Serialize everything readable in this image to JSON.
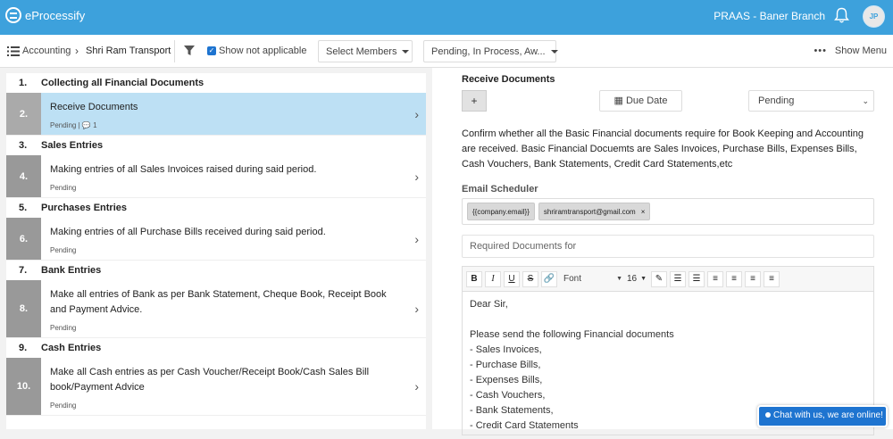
{
  "app": {
    "name": "eProcessify",
    "branch": "PRAAS - Baner Branch",
    "user_initials": "JP"
  },
  "toolbar": {
    "crumb_root": "Accounting",
    "crumb_current": "Shri Ram Transport",
    "show_not_applicable": "Show not applicable",
    "members_select": "Select Members",
    "status_filter": "Pending, In Process, Aw...",
    "show_menu": "Show Menu"
  },
  "tasks": [
    {
      "type": "section",
      "num": "1.",
      "title": "Collecting all Financial Documents"
    },
    {
      "type": "task",
      "num": "2.",
      "title": "Receive Documents",
      "status": "Pending  |  💬 1",
      "active": true
    },
    {
      "type": "section",
      "num": "3.",
      "title": "Sales Entries"
    },
    {
      "type": "task",
      "num": "4.",
      "title": "Making entries of all Sales Invoices raised during said period.",
      "status": "Pending"
    },
    {
      "type": "section",
      "num": "5.",
      "title": "Purchases Entries"
    },
    {
      "type": "task",
      "num": "6.",
      "title": "Making entries of all Purchase Bills received during said period.",
      "status": "Pending"
    },
    {
      "type": "section",
      "num": "7.",
      "title": "Bank Entries"
    },
    {
      "type": "task",
      "num": "8.",
      "title": "Make all entries of Bank as per Bank Statement, Cheque Book, Receipt Book and Payment Advice.",
      "status": "Pending"
    },
    {
      "type": "section",
      "num": "9.",
      "title": "Cash Entries"
    },
    {
      "type": "task",
      "num": "10.",
      "title": "Make all Cash entries as per Cash Voucher/Receipt Book/Cash Sales Bill book/Payment Advice",
      "status": "Pending"
    }
  ],
  "detail": {
    "title": "Receive Documents",
    "plus": "+",
    "due_date": "Due Date",
    "status": "Pending",
    "description": "Confirm whether all the Basic Financial documents require for Book Keeping and Accounting are received. Basic Financial Docuemts are Sales Invoices, Purchase Bills, Expenses Bills, Cash Vouchers, Bank Statements, Credit Card Statements,etc",
    "email_label": "Email Scheduler",
    "email_tags": [
      "{{company.email}}",
      "shriramtransport@gmail.com"
    ],
    "required_placeholder": "Required Documents for",
    "editor": {
      "font": "Font",
      "size": "16",
      "lines": [
        "Dear Sir,",
        "",
        "Please send the following Financial documents",
        " - Sales Invoices,",
        " - Purchase Bills,",
        " - Expenses Bills,",
        " - Cash Vouchers,",
        " - Bank Statements,",
        " - Credit Card Statements"
      ]
    }
  },
  "chat": {
    "label": "Chat with us, we are online!"
  },
  "colors": {
    "topbar": "#3da1dc",
    "active_row": "#bde0f4",
    "chat": "#1e74d0"
  }
}
